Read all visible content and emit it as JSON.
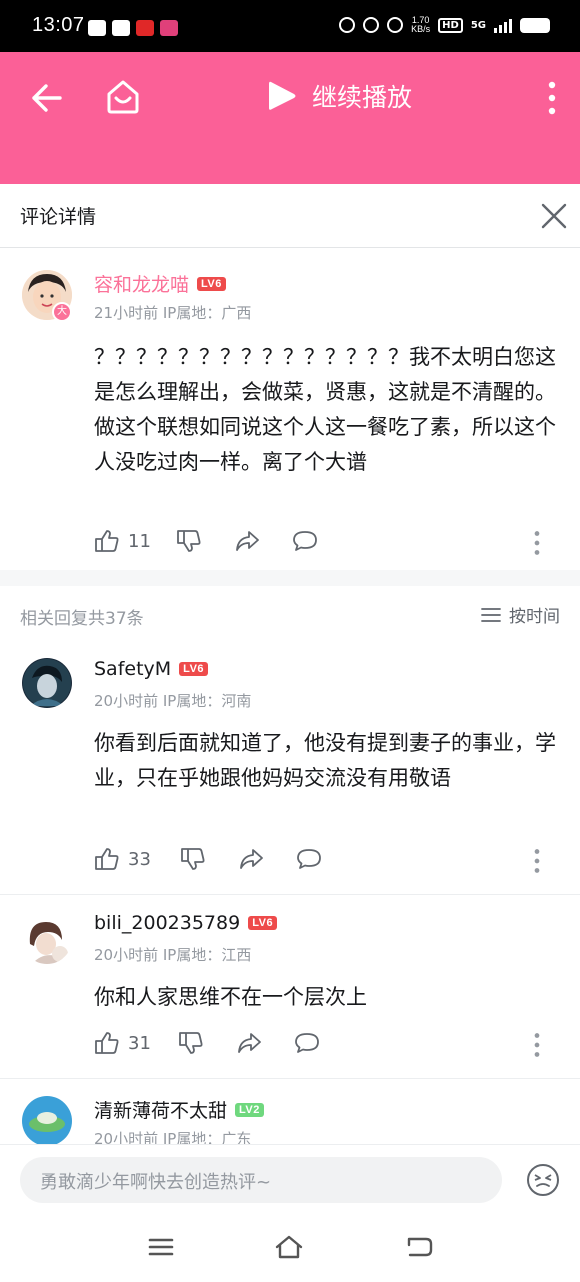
{
  "status_bar": {
    "time": "13:07",
    "net_speed_value": "1.70",
    "net_speed_unit": "KB/s",
    "hd": "HD",
    "network": "5G"
  },
  "top_bar": {
    "continue_label": "继续播放",
    "accent_color": "#fb6097"
  },
  "detail_header": {
    "title": "评论详情"
  },
  "main_comment": {
    "username": "容和龙龙喵",
    "level": "LV6",
    "meta": "21小时前 IP属地：广西",
    "text": "？？？？？？？？？？？？？？？我不太明白您这是怎么理解出，会做菜，贤惠，这就是不清醒的。做这个联想如同说这个人这一餐吃了素，所以这个人没吃过肉一样。离了个大谱",
    "likes": "11"
  },
  "related": {
    "count_label": "相关回复共37条",
    "sort_label": "按时间"
  },
  "replies": [
    {
      "username": "SafetyM",
      "level": "LV6",
      "meta": "20小时前 IP属地：河南",
      "text": "你看到后面就知道了，他没有提到妻子的事业，学业，只在乎她跟他妈妈交流没有用敬语",
      "likes": "33"
    },
    {
      "username": "bili_200235789",
      "level": "LV6",
      "meta": "20小时前 IP属地：江西",
      "text": "你和人家思维不在一个层次上",
      "likes": "31"
    },
    {
      "username": "清新薄荷不太甜",
      "level": "LV2",
      "meta": "20小时前 IP属地：广东"
    }
  ],
  "input_bar": {
    "placeholder": "勇敢滴少年啊快去创造热评~"
  },
  "icons": [
    "back-icon",
    "home-icon",
    "play-icon",
    "more-icon",
    "close-icon",
    "like-icon",
    "dislike-icon",
    "share-icon",
    "reply-icon",
    "sort-icon",
    "emoji-icon",
    "menu-icon",
    "nav-home-icon",
    "nav-back-icon"
  ]
}
